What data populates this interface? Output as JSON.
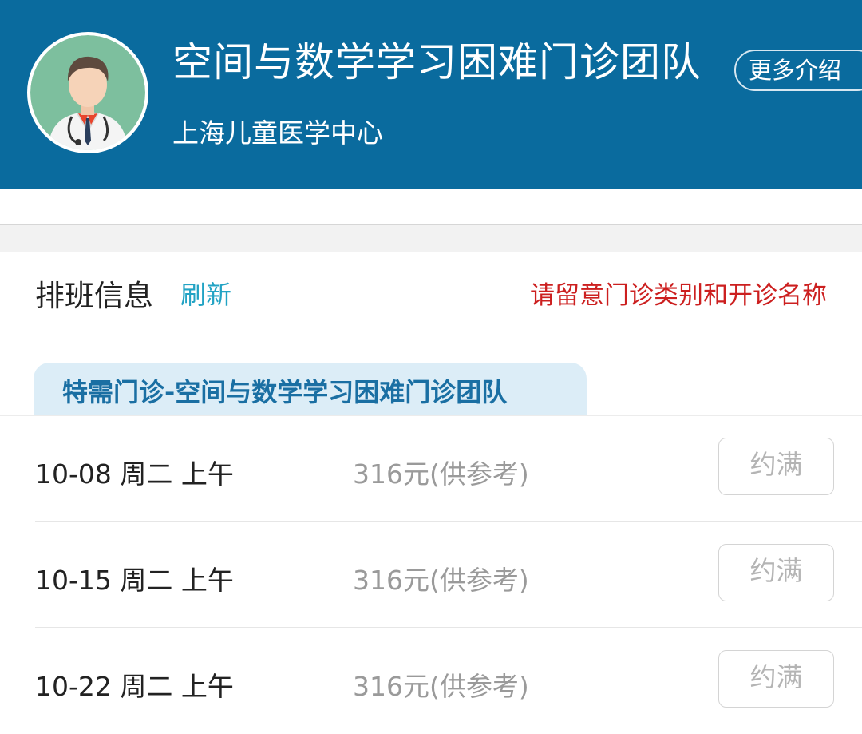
{
  "header": {
    "team_title": "空间与数学学习困难门诊团队",
    "hospital": "上海儿童医学中心",
    "more_button": "更多介绍",
    "avatar_icon": "doctor-avatar-icon",
    "colors": {
      "background": "#0a6b9e"
    }
  },
  "schedule": {
    "label": "排班信息",
    "refresh": "刷新",
    "notice": "请留意门诊类别和开诊名称",
    "colors": {
      "refresh": "#22a3c4",
      "notice": "#cc1f1f"
    }
  },
  "clinic": {
    "tab_label": "特需门诊-空间与数学学习困难门诊团队"
  },
  "slots": [
    {
      "date": "10-08 周二 上午",
      "price": "316元(供参考)",
      "status": "约满"
    },
    {
      "date": "10-15 周二 上午",
      "price": "316元(供参考)",
      "status": "约满"
    },
    {
      "date": "10-22 周二 上午",
      "price": "316元(供参考)",
      "status": "约满"
    }
  ]
}
